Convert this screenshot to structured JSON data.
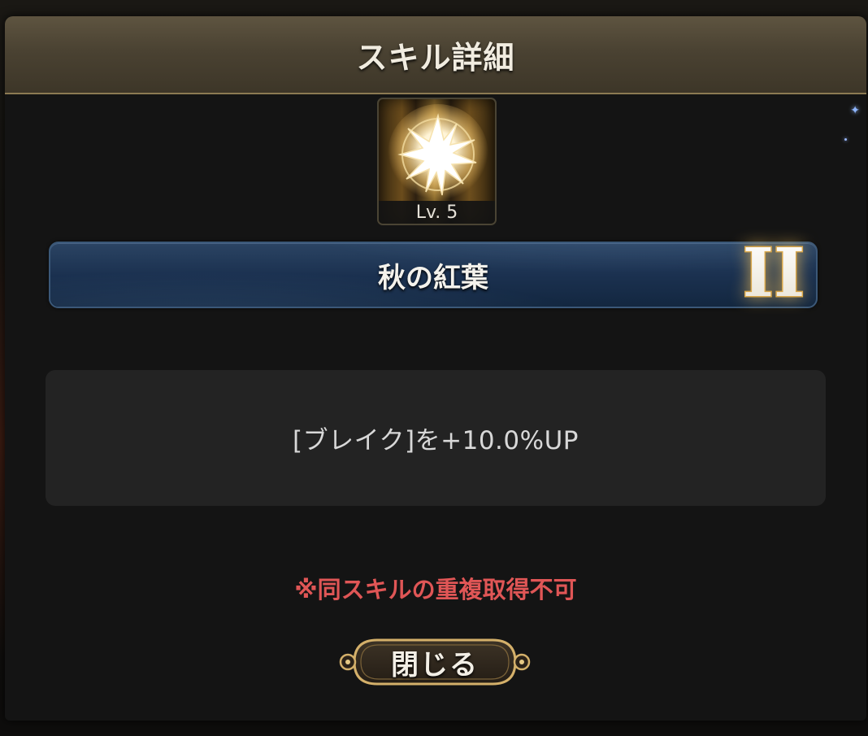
{
  "dialog": {
    "title": "スキル詳細"
  },
  "skill": {
    "icon": "radiant-burst-icon",
    "level_label": "Lv. 5",
    "name": "秋の紅葉",
    "rank": "II",
    "description": "[ブレイク]を+10.0%UP",
    "note": "※同スキルの重複取得不可"
  },
  "actions": {
    "close_label": "閉じる"
  },
  "colors": {
    "header": "#4a4232",
    "name_bar": "#1b3150",
    "note_red": "#e05656",
    "gold": "#c9a45a"
  }
}
